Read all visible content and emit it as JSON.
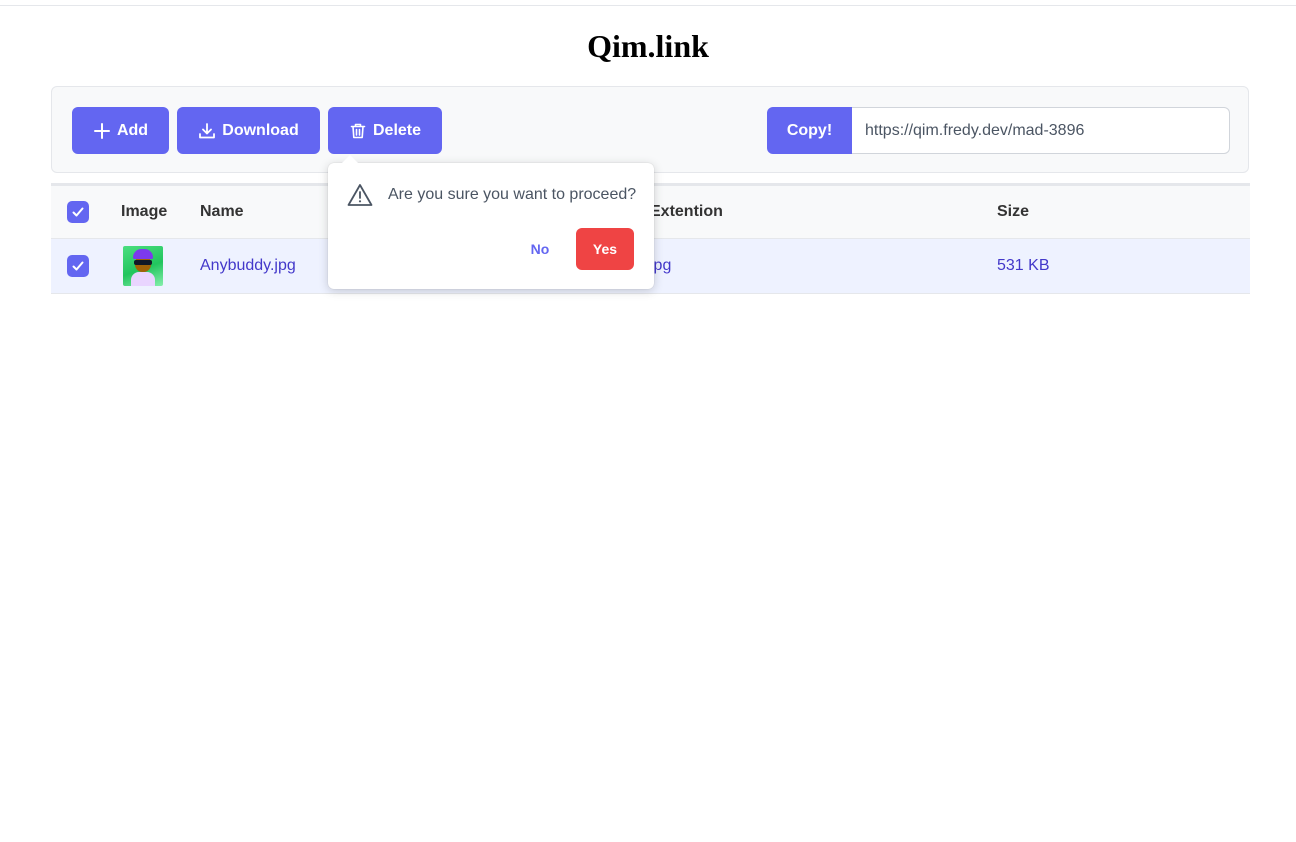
{
  "app": {
    "title": "Qim.link"
  },
  "toolbar": {
    "add_label": "Add",
    "download_label": "Download",
    "delete_label": "Delete",
    "copy_label": "Copy!",
    "url_value": "https://qim.fredy.dev/mad-3896"
  },
  "table": {
    "headers": {
      "image": "Image",
      "name": "Name",
      "extension": "Extention",
      "size": "Size"
    },
    "rows": [
      {
        "name": "Anybuddy.jpg",
        "extension": "jpg",
        "size": "531 KB",
        "selected": true,
        "thumbnail": "avatar-thumbnail"
      }
    ],
    "select_all": true
  },
  "confirm_popup": {
    "message": "Are you sure you want to proceed?",
    "no_label": "No",
    "yes_label": "Yes",
    "icon": "warning-icon"
  },
  "colors": {
    "primary": "#6366f1",
    "danger": "#ef4444",
    "selected_row": "#eef2ff",
    "link_text": "#4338ca"
  }
}
